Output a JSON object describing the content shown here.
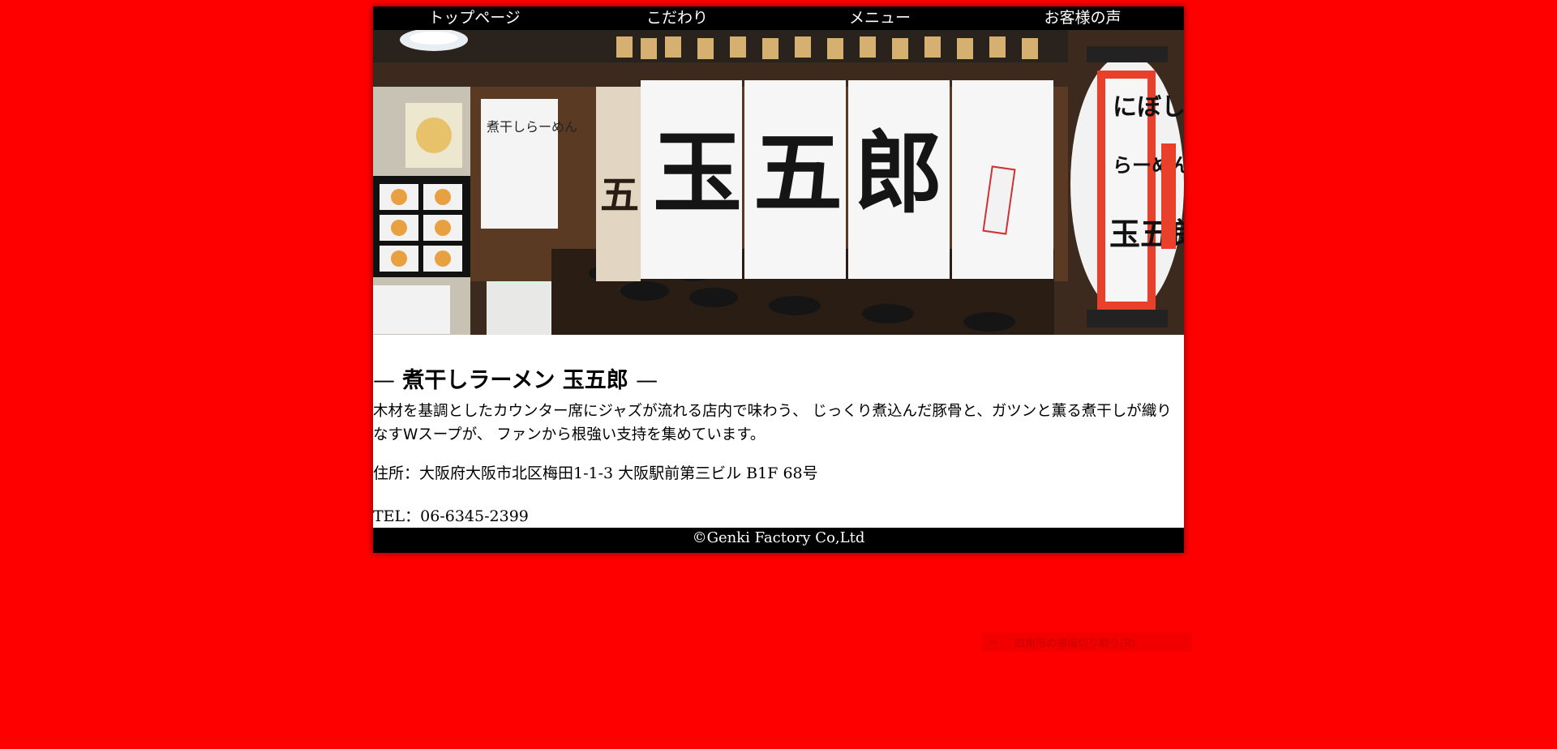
{
  "nav": {
    "items": [
      {
        "label": "トップページ"
      },
      {
        "label": "こだわり"
      },
      {
        "label": "メニュー"
      },
      {
        "label": "お客様の声"
      }
    ]
  },
  "hero": {
    "noren_text": "玉五郎",
    "side_noren_text": "煮干しらーめん",
    "lantern_top": "にぼし",
    "lantern_middle": "らーめん",
    "lantern_bottom": "玉五郎",
    "colors": {
      "wood": "#5a3a22",
      "noren": "#f4f4f4",
      "lantern_red": "#e8402a"
    }
  },
  "shop": {
    "title_dash_left": "—",
    "title": "煮干しラーメン 玉五郎",
    "title_dash_right": "—",
    "description": "木材を基調としたカウンター席にジャズが流れる店内で味わう、 じっくり煮込んだ豚骨と、ガツンと薫る煮干しが織りなすWスープが、 ファンから根強い支持を集めています。",
    "address": "住所：大阪府大阪市北区梅田1-1-3 大阪駅前第三ビル B1F 68号",
    "tel": "TEL：06-6345-2399"
  },
  "footer": {
    "copyright": "©Genki Factory Co,Ltd"
  },
  "context_menu": {
    "icon": "scissors-icon",
    "label": "四角形の領域切り取り(R)"
  },
  "colors": {
    "background": "#ff0000",
    "nav_bg": "#000000",
    "footer_bg": "#000000"
  }
}
